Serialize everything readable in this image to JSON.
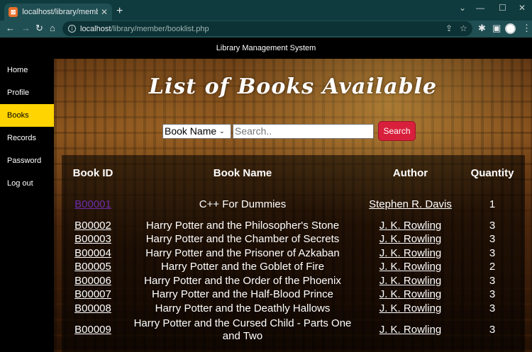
{
  "browser": {
    "tab_title": "localhost/library/member/bookli",
    "new_tab": "+",
    "url_host": "localhost",
    "url_path": "/library/member/booklist.php"
  },
  "page": {
    "topbar_title": "Library Management System",
    "heading": "List of Books Available"
  },
  "sidebar": {
    "items": [
      {
        "label": "Home"
      },
      {
        "label": "Profile"
      },
      {
        "label": "Books",
        "active": true
      },
      {
        "label": "Records"
      },
      {
        "label": "Password"
      },
      {
        "label": "Log out"
      }
    ]
  },
  "search": {
    "select_value": "Book Name",
    "placeholder": "Search..",
    "button_label": "Search"
  },
  "table": {
    "headers": {
      "id": "Book ID",
      "name": "Book Name",
      "author": "Author",
      "quantity": "Quantity"
    },
    "rows": [
      {
        "id": "B00001",
        "name": "C++ For Dummies",
        "author": "Stephen R. Davis",
        "quantity": "1"
      },
      {
        "id": "B00002",
        "name": "Harry Potter and the Philosopher's Stone",
        "author": "J. K. Rowling",
        "quantity": "3"
      },
      {
        "id": "B00003",
        "name": "Harry Potter and the Chamber of Secrets",
        "author": "J. K. Rowling",
        "quantity": "3"
      },
      {
        "id": "B00004",
        "name": "Harry Potter and the Prisoner of Azkaban",
        "author": "J. K. Rowling",
        "quantity": "3"
      },
      {
        "id": "B00005",
        "name": "Harry Potter and the Goblet of Fire",
        "author": "J. K. Rowling",
        "quantity": "2"
      },
      {
        "id": "B00006",
        "name": "Harry Potter and the Order of the Phoenix",
        "author": "J. K. Rowling",
        "quantity": "3"
      },
      {
        "id": "B00007",
        "name": "Harry Potter and the Half-Blood Prince",
        "author": "J. K. Rowling",
        "quantity": "3"
      },
      {
        "id": "B00008",
        "name": "Harry Potter and the Deathly Hallows",
        "author": "J. K. Rowling",
        "quantity": "3"
      },
      {
        "id": "B00009",
        "name": "Harry Potter and the Cursed Child - Parts One and Two",
        "author": "J. K. Rowling",
        "quantity": "3"
      }
    ]
  },
  "colors": {
    "accent": "#ffd400",
    "search_button": "#d81f3c",
    "browser_frame": "#0f3b3e"
  }
}
